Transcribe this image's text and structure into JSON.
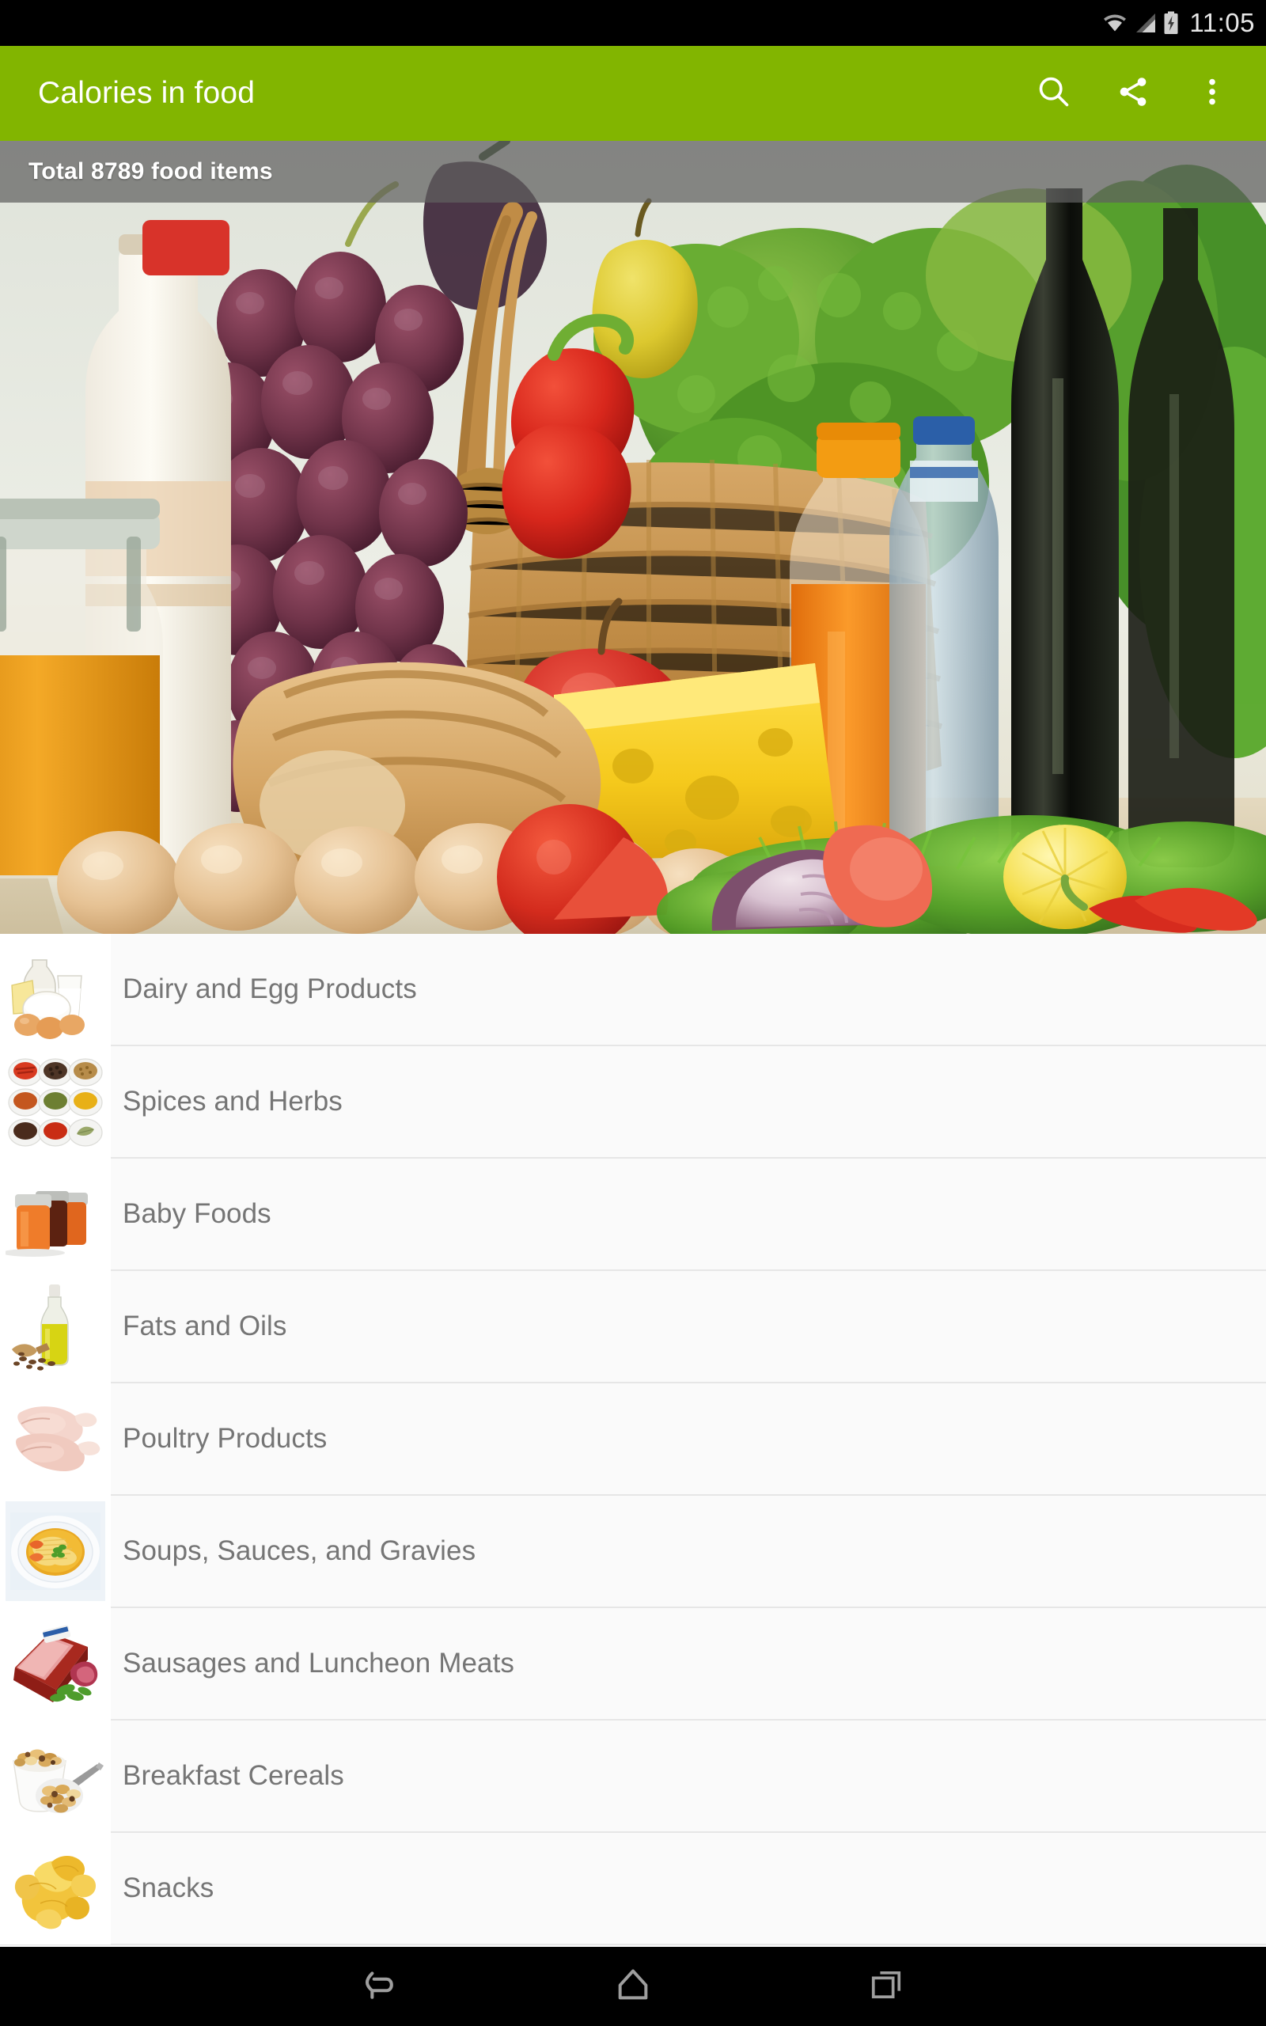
{
  "status_bar": {
    "time": "11:05",
    "icons": [
      "wifi-icon",
      "cellular-signal-icon",
      "battery-charging-icon"
    ]
  },
  "app_bar": {
    "title": "Calories in food",
    "background_color": "#82b500",
    "title_color": "#ffffff",
    "actions": [
      {
        "name": "search-icon",
        "label": "Search"
      },
      {
        "name": "share-icon",
        "label": "Share"
      },
      {
        "name": "overflow-menu-icon",
        "label": "More options"
      }
    ]
  },
  "hero": {
    "banner_text": "Total 8789 food items",
    "total_items": 8789,
    "banner_background": "rgba(96,96,96,0.72)",
    "image_alt": "Assorted fresh foods: milk bottles, honey jar, grapes, peppers, basket with apple and pear, broccoli, cheese, bread, eggs, tomato, onion, lemon, chili peppers, juice and wine bottles"
  },
  "list": {
    "items": [
      {
        "label": "Dairy and Egg Products",
        "thumb": "dairy-eggs-thumb"
      },
      {
        "label": "Spices and Herbs",
        "thumb": "spices-herbs-thumb"
      },
      {
        "label": "Baby Foods",
        "thumb": "baby-foods-thumb"
      },
      {
        "label": "Fats and Oils",
        "thumb": "fats-oils-thumb"
      },
      {
        "label": "Poultry Products",
        "thumb": "poultry-thumb"
      },
      {
        "label": "Soups, Sauces, and Gravies",
        "thumb": "soups-thumb"
      },
      {
        "label": "Sausages and Luncheon Meats",
        "thumb": "sausages-thumb"
      },
      {
        "label": "Breakfast Cereals",
        "thumb": "cereals-thumb"
      },
      {
        "label": "Snacks",
        "thumb": "snacks-thumb"
      }
    ],
    "text_color": "#757575",
    "background_color": "#fafafa"
  },
  "nav_bar": {
    "buttons": [
      {
        "name": "back-nav-icon",
        "label": "Back"
      },
      {
        "name": "home-nav-icon",
        "label": "Home"
      },
      {
        "name": "recents-nav-icon",
        "label": "Recent apps"
      }
    ]
  }
}
